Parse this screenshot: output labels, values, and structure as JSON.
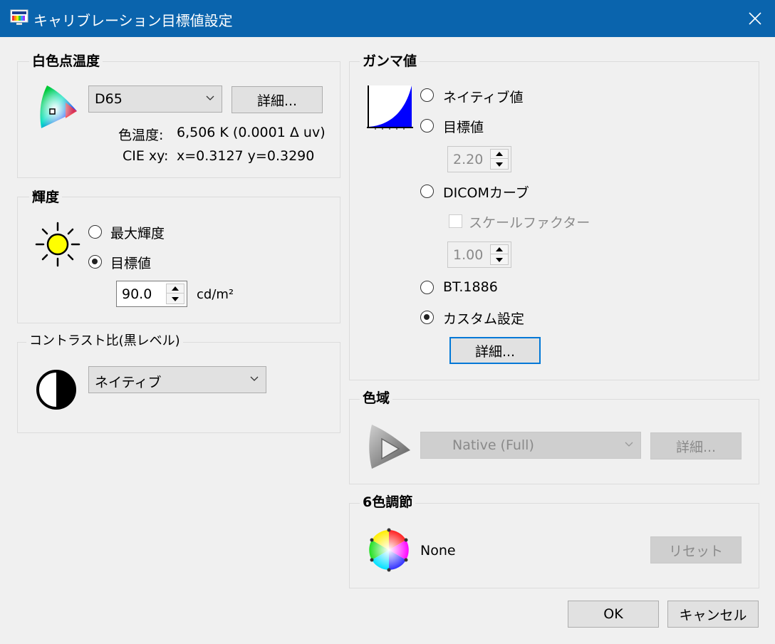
{
  "window": {
    "title": "キャリブレーション目標値設定",
    "close_label": "×"
  },
  "white_point": {
    "label": "白色点温度",
    "preset": "D65",
    "detail_button": "詳細...",
    "color_temp_label": "色温度:",
    "color_temp_value": "6,506 K (0.0001 Δ uv)",
    "cie_label": "CIE xy:",
    "cie_value": "x=0.3127 y=0.3290"
  },
  "luminance": {
    "label": "輝度",
    "option_max": "最大輝度",
    "option_target": "目標値",
    "selected": "target",
    "value": "90.0",
    "unit": "cd/m²"
  },
  "contrast": {
    "label": "コントラスト比(黒レベル)",
    "value": "ネイティブ"
  },
  "gamma": {
    "label": "ガンマ値",
    "option_native": "ネイティブ値",
    "option_target": "目標値",
    "target_value": "2.20",
    "option_dicom": "DICOMカーブ",
    "scale_factor_label": "スケールファクター",
    "scale_factor_value": "1.00",
    "option_bt1886": "BT.1886",
    "option_custom": "カスタム設定",
    "selected": "custom",
    "detail_button": "詳細..."
  },
  "gamut": {
    "label": "色域",
    "value": "Native (Full)",
    "detail_button": "詳細..."
  },
  "six_color": {
    "label": "6色調節",
    "value": "None",
    "reset_button": "リセット"
  },
  "footer": {
    "ok": "OK",
    "cancel": "キャンセル"
  },
  "colors": {
    "titlebar": "#0a64ad",
    "gamma_curve": "#0000ff",
    "sun": "#ffff00",
    "default_button_border": "#0078d7"
  }
}
